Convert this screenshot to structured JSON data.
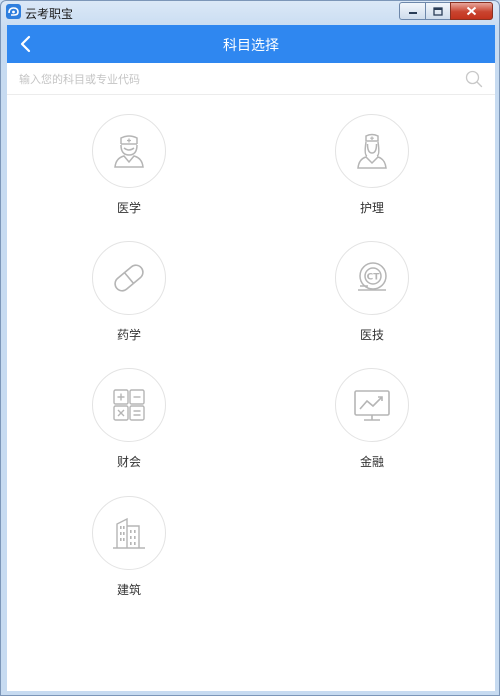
{
  "window": {
    "title": "云考职宝"
  },
  "header": {
    "title": "科目选择"
  },
  "search": {
    "placeholder": "输入您的科目或专业代码",
    "value": ""
  },
  "categories": [
    {
      "label": "医学",
      "icon": "doctor-icon"
    },
    {
      "label": "护理",
      "icon": "nurse-icon"
    },
    {
      "label": "药学",
      "icon": "pill-icon"
    },
    {
      "label": "医技",
      "icon": "ct-scan-icon"
    },
    {
      "label": "财会",
      "icon": "calculator-icon"
    },
    {
      "label": "金融",
      "icon": "chart-monitor-icon"
    },
    {
      "label": "建筑",
      "icon": "building-icon"
    }
  ],
  "colors": {
    "accent": "#2f87f0",
    "icon_gray": "#b5b5b5"
  }
}
